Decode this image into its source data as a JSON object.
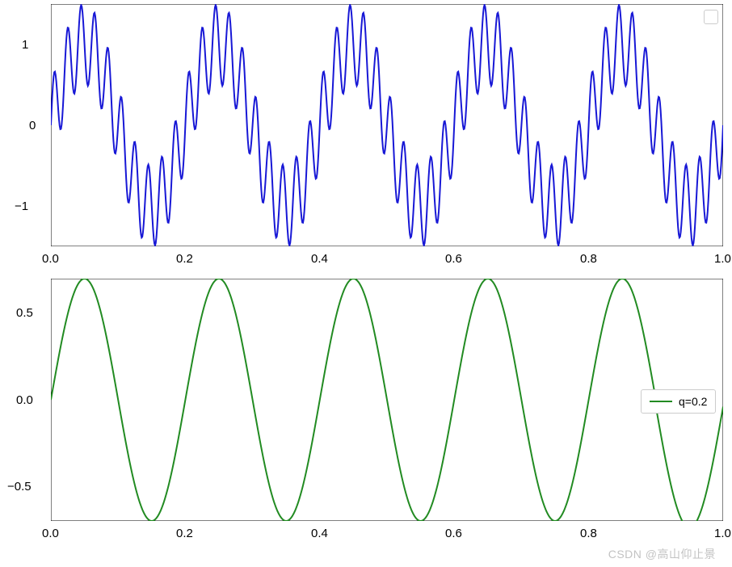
{
  "chart_data": [
    {
      "type": "line",
      "x_range": [
        0.0,
        1.0
      ],
      "y_range": [
        -1.5,
        1.5
      ],
      "formula": "sin(2*pi*5*t) + 0.5*sin(2*pi*50*t)",
      "xticks": [
        0.0,
        0.2,
        0.4,
        0.6,
        0.8,
        1.0
      ],
      "yticks": [
        -1,
        0,
        1
      ],
      "series": [
        {
          "name": "",
          "color": "#1818d6",
          "function": "sum_of_sines_5hz_50hz"
        }
      ],
      "legend": {
        "position": "upper-right",
        "label": ""
      }
    },
    {
      "type": "line",
      "x_range": [
        0.0,
        1.0
      ],
      "y_range": [
        -0.7,
        0.7
      ],
      "formula": "0.7*sin(2*pi*5*t)",
      "xticks": [
        0.0,
        0.2,
        0.4,
        0.6,
        0.8,
        1.0
      ],
      "yticks": [
        -0.5,
        0.0,
        0.5
      ],
      "series": [
        {
          "name": "q=0.2",
          "color": "#228B22",
          "function": "sine_5hz_scaled"
        }
      ],
      "legend": {
        "position": "right",
        "label": "q=0.2"
      }
    }
  ],
  "xtick_labels_top": [
    "0.0",
    "0.2",
    "0.4",
    "0.6",
    "0.8",
    "1.0"
  ],
  "ytick_labels_top": [
    "−1",
    "0",
    "1"
  ],
  "xtick_labels_bottom": [
    "0.0",
    "0.2",
    "0.4",
    "0.6",
    "0.8",
    "1.0"
  ],
  "ytick_labels_bottom": [
    "−0.5",
    "0.0",
    "0.5"
  ],
  "legend_bottom_label": "q=0.2",
  "watermark": "CSDN @高山仰止景"
}
